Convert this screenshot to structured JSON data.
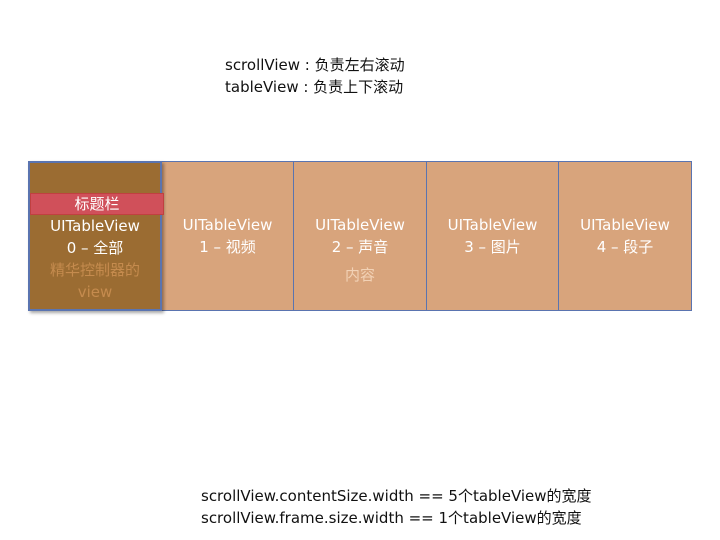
{
  "top_notes": [
    "scrollView : 负责左右滚动",
    "tableView : 负责上下滚动"
  ],
  "title_bar_label": "标题栏",
  "cells": [
    {
      "name": "UITableView",
      "sub": "0 – 全部"
    },
    {
      "name": "UITableView",
      "sub": "1 – 视频"
    },
    {
      "name": "UITableView",
      "sub": "2 – 声音"
    },
    {
      "name": "UITableView",
      "sub": "3 – 图片"
    },
    {
      "name": "UITableView",
      "sub": "4 – 段子"
    }
  ],
  "controller_view_label": [
    "精华控制器的",
    "view"
  ],
  "content_label": "内容",
  "bottom_notes": [
    "scrollView.contentSize.width == 5个tableView的宽度",
    "scrollView.frame.size.width == 1个tableView的宽度"
  ],
  "colors": {
    "cell_fill": "#d8a47c",
    "selected_fill": "#9b6c32",
    "title_bar": "#d0505a",
    "border": "#5a74b0"
  }
}
